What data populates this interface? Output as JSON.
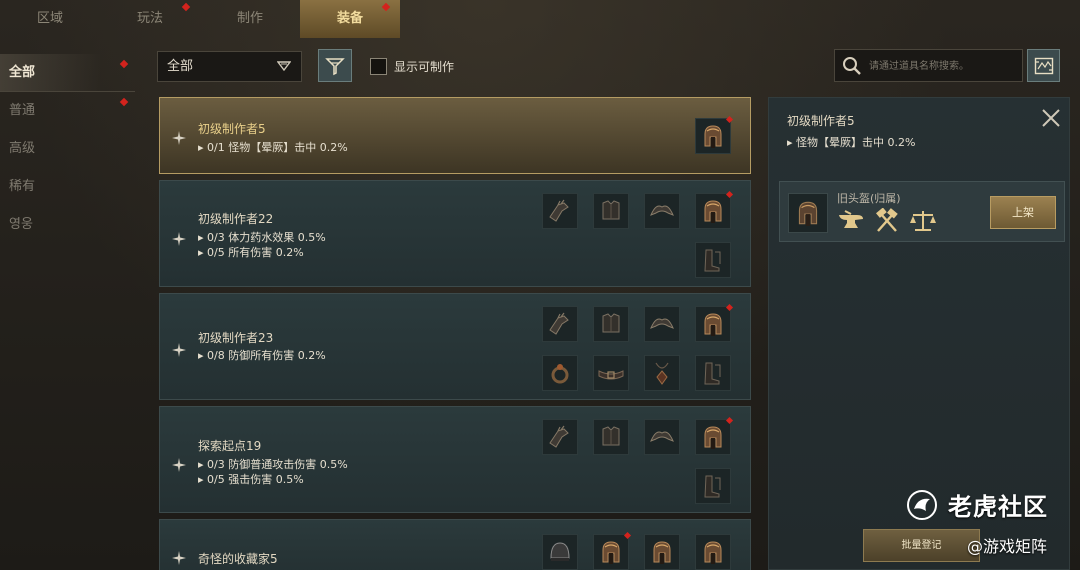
{
  "tabs": [
    {
      "label": "区域",
      "active": false,
      "dot": false
    },
    {
      "label": "玩法",
      "active": false,
      "dot": true
    },
    {
      "label": "制作",
      "active": false,
      "dot": false
    },
    {
      "label": "装备",
      "active": true,
      "dot": true
    }
  ],
  "sidebar": [
    {
      "label": "全部",
      "active": true,
      "dot": true
    },
    {
      "label": "普通",
      "active": false,
      "dot": true
    },
    {
      "label": "高级",
      "active": false,
      "dot": false
    },
    {
      "label": "稀有",
      "active": false,
      "dot": false
    },
    {
      "label": "영웅",
      "active": false,
      "dot": false
    }
  ],
  "filters": {
    "dropdown_value": "全部",
    "show_craftable_label": "显示可制作",
    "show_craftable_checked": false
  },
  "search": {
    "placeholder": "请通过道具名称搜索。"
  },
  "list": {
    "cards": [
      {
        "title": "初级制作者5",
        "lines": [
          "▸ 0/1 怪物【晕厥】击中 0.2%"
        ],
        "selected": true,
        "items": [
          {
            "icon": "helmet-icon",
            "dot": true
          }
        ]
      },
      {
        "title": "初级制作者22",
        "lines": [
          "▸ 0/3 体力药水效果 0.5%",
          "▸ 0/5 所有伤害 0.2%"
        ],
        "selected": false,
        "items": [
          {
            "icon": "gauntlet-icon",
            "dot": false
          },
          {
            "icon": "chest-armor-icon",
            "dot": false
          },
          {
            "icon": "shoulder-icon",
            "dot": false
          },
          {
            "icon": "helmet-icon",
            "dot": true
          },
          {
            "icon": "boots-icon",
            "dot": false
          }
        ]
      },
      {
        "title": "初级制作者23",
        "lines": [
          "▸ 0/8 防御所有伤害 0.2%"
        ],
        "selected": false,
        "items": [
          {
            "icon": "gauntlet-icon",
            "dot": false
          },
          {
            "icon": "chest-armor-icon",
            "dot": false
          },
          {
            "icon": "shoulder-icon",
            "dot": false
          },
          {
            "icon": "helmet-icon",
            "dot": true
          },
          {
            "icon": "ring-icon",
            "dot": false
          },
          {
            "icon": "belt-icon",
            "dot": false
          },
          {
            "icon": "amulet-icon",
            "dot": false
          },
          {
            "icon": "boots-icon",
            "dot": false
          }
        ]
      },
      {
        "title": "探索起点19",
        "lines": [
          "▸ 0/3 防御普通攻击伤害 0.5%",
          "▸ 0/5 强击伤害 0.5%"
        ],
        "selected": false,
        "items": [
          {
            "icon": "gauntlet-icon",
            "dot": false
          },
          {
            "icon": "chest-armor-icon",
            "dot": false
          },
          {
            "icon": "shoulder-icon",
            "dot": false
          },
          {
            "icon": "helmet-icon",
            "dot": true
          },
          {
            "icon": "boots-icon",
            "dot": false
          }
        ]
      },
      {
        "title": "奇怪的收藏家5",
        "lines": [],
        "selected": false,
        "items": [
          {
            "icon": "round-helmet-icon",
            "dot": false
          },
          {
            "icon": "helmet-icon",
            "dot": true
          },
          {
            "icon": "helmet-icon",
            "dot": false
          },
          {
            "icon": "helmet-icon",
            "dot": false
          }
        ]
      }
    ]
  },
  "detail": {
    "title": "初级制作者5",
    "line": "▸ 怪物【晕厥】击中 0.2%",
    "entry": {
      "name": "旧头盔(归属)",
      "icon": "helmet-icon",
      "craft_icons": [
        "anvil-icon",
        "crossed-hammers-icon",
        "scales-icon"
      ],
      "button_label": "上架"
    },
    "batch_button_label": "批量登记"
  },
  "watermark": {
    "line1": "老虎社区",
    "line2": "@游戏矩阵"
  },
  "colors": {
    "accent_gold": "#8a7142",
    "notification_red": "#d3231d",
    "card_teal": "#2b3a3c"
  }
}
